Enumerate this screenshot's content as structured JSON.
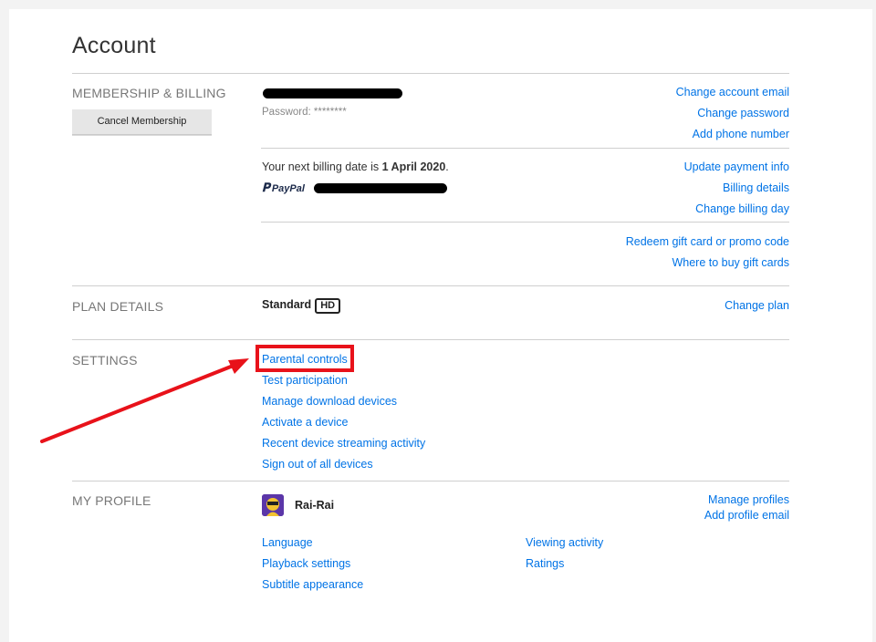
{
  "page_title": "Account",
  "membership": {
    "label": "MEMBERSHIP & BILLING",
    "cancel_button": "Cancel Membership",
    "password_text": "Password: ********",
    "links_account": [
      "Change account email",
      "Change password",
      "Add phone number"
    ],
    "billing_prefix": "Your next billing date is ",
    "billing_date": "1 April 2020",
    "billing_suffix": ".",
    "paypal_label": "PayPal",
    "links_billing": [
      "Update payment info",
      "Billing details",
      "Change billing day"
    ],
    "links_gift": [
      "Redeem gift card or promo code",
      "Where to buy gift cards"
    ]
  },
  "plan": {
    "label": "PLAN DETAILS",
    "name": "Standard",
    "badge": "HD",
    "change_link": "Change plan"
  },
  "settings": {
    "label": "SETTINGS",
    "links": [
      "Parental controls",
      "Test participation",
      "Manage download devices",
      "Activate a device",
      "Recent device streaming activity",
      "Sign out of all devices"
    ]
  },
  "profile": {
    "label": "MY PROFILE",
    "name": "Rai-Rai",
    "right_links": [
      "Manage profiles",
      "Add profile email"
    ],
    "col1_links": [
      "Language",
      "Playback settings",
      "Subtitle appearance"
    ],
    "col2_links": [
      "Viewing activity",
      "Ratings"
    ]
  },
  "colors": {
    "link": "#0073e6",
    "annotation_red": "#e8121a",
    "section_label": "#777777"
  }
}
